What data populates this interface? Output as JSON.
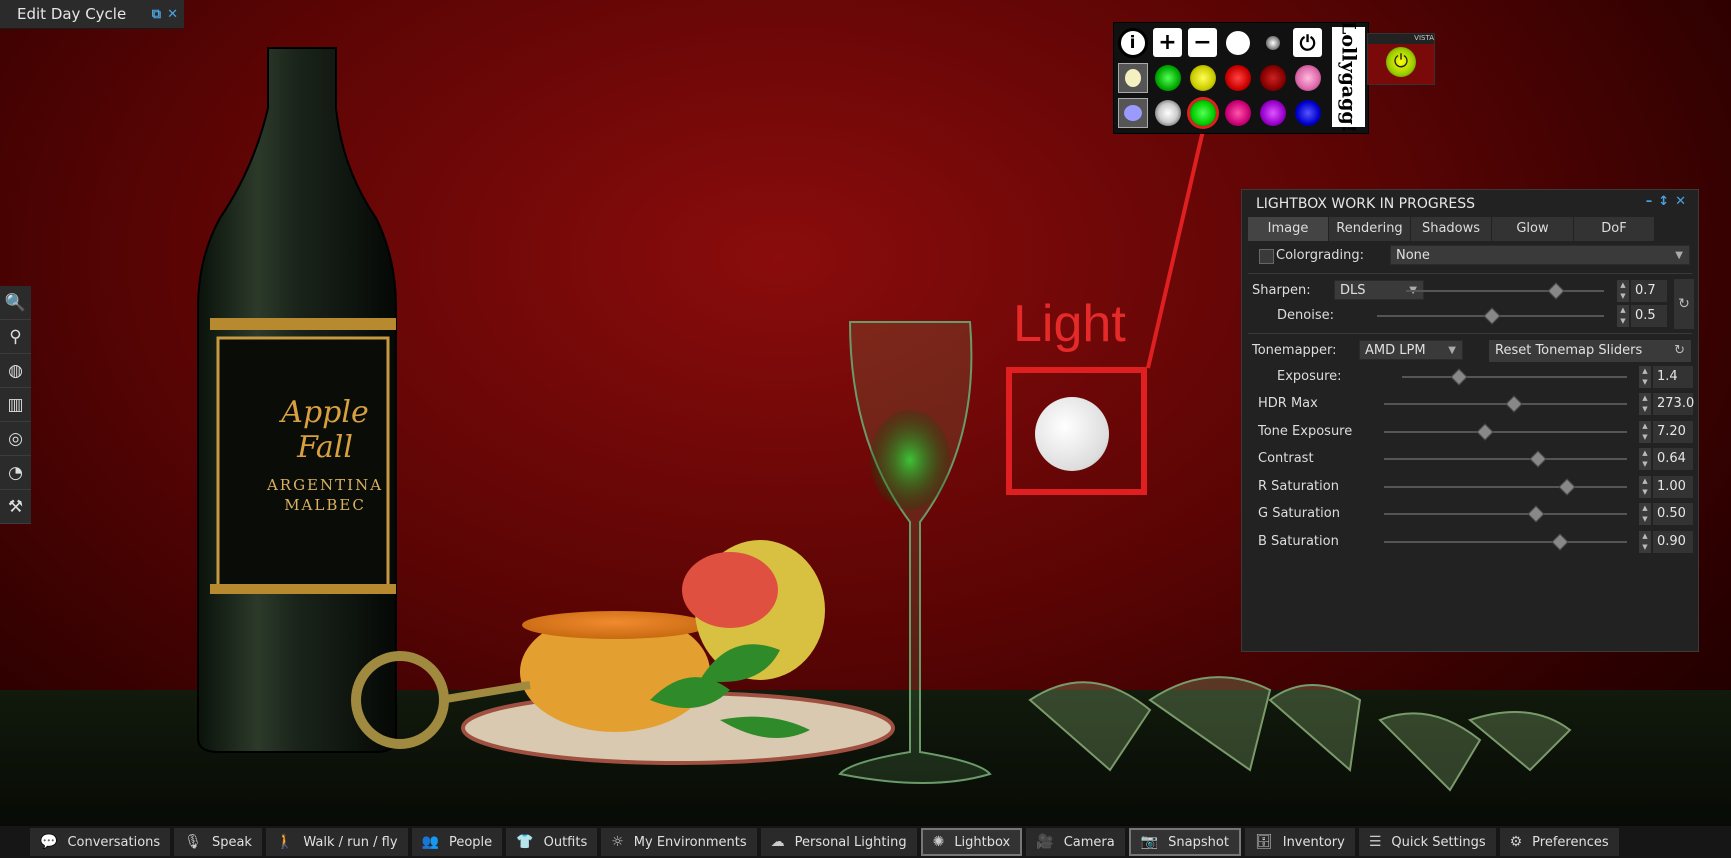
{
  "window": {
    "title": "Edit Day Cycle"
  },
  "left_toolbar": [
    {
      "icon": "search-icon",
      "glyph": "🔍"
    },
    {
      "icon": "location-pin-icon",
      "glyph": "⚲"
    },
    {
      "icon": "globe-icon",
      "glyph": "◍"
    },
    {
      "icon": "map-icon",
      "glyph": "▥"
    },
    {
      "icon": "radar-icon",
      "glyph": "◎"
    },
    {
      "icon": "speedometer-icon",
      "glyph": "◔"
    },
    {
      "icon": "build-hammer-icon",
      "glyph": "⚒"
    }
  ],
  "hud": {
    "logo_text": "Lollygagg!",
    "vista_label": "VISTA",
    "buttons": [
      "i",
      "+",
      "-"
    ]
  },
  "annotation": {
    "label": "Light"
  },
  "scene": {
    "bottle_brand": "Apple Fall",
    "bottle_type": "ARGENTINA",
    "bottle_wine": "MALBEC"
  },
  "lightbox": {
    "title": "LIGHTBOX WORK IN PROGRESS",
    "tabs": [
      "Image",
      "Rendering",
      "Shadows",
      "Glow",
      "DoF"
    ],
    "active_tab": "Image",
    "colorgrading": {
      "label": "Colorgrading:",
      "value": "None",
      "checked": false
    },
    "sharpen": {
      "label": "Sharpen:",
      "mode": "DLS",
      "value": "0.7",
      "pos": 0.75
    },
    "denoise": {
      "label": "Denoise:",
      "value": "0.5",
      "pos": 0.5
    },
    "tonemapper": {
      "label": "Tonemapper:",
      "value": "AMD LPM",
      "reset_label": "Reset Tonemap Sliders"
    },
    "sliders": [
      {
        "label": "Exposure:",
        "value": "1.4",
        "pos": 0.25
      },
      {
        "label": "HDR Max",
        "value": "273.0",
        "pos": 0.53
      },
      {
        "label": "Tone Exposure",
        "value": "7.20",
        "pos": 0.41
      },
      {
        "label": "Contrast",
        "value": "0.64",
        "pos": 0.63
      },
      {
        "label": "R Saturation",
        "value": "1.00",
        "pos": 0.75
      },
      {
        "label": "G Saturation",
        "value": "0.50",
        "pos": 0.62
      },
      {
        "label": "B Saturation",
        "value": "0.90",
        "pos": 0.72
      }
    ]
  },
  "bottom_bar": [
    {
      "label": "Conversations",
      "icon": "chat-bubble-icon",
      "glyph": "💬",
      "selected": false
    },
    {
      "label": "Speak",
      "icon": "microphone-icon",
      "glyph": "🎙",
      "selected": false
    },
    {
      "label": "Walk / run / fly",
      "icon": "walk-icon",
      "glyph": "🚶",
      "selected": false
    },
    {
      "label": "People",
      "icon": "people-icon",
      "glyph": "👥",
      "selected": false
    },
    {
      "label": "Outfits",
      "icon": "tshirt-icon",
      "glyph": "👕",
      "selected": false
    },
    {
      "label": "My Environments",
      "icon": "sun-icon",
      "glyph": "☼",
      "selected": false
    },
    {
      "label": "Personal Lighting",
      "icon": "cloud-icon",
      "glyph": "☁",
      "selected": false
    },
    {
      "label": "Lightbox",
      "icon": "lightbox-icon",
      "glyph": "✺",
      "selected": true
    },
    {
      "label": "Camera",
      "icon": "camera-icon",
      "glyph": "🎥",
      "selected": false
    },
    {
      "label": "Snapshot",
      "icon": "snapshot-icon",
      "glyph": "📷",
      "selected": true
    },
    {
      "label": "Inventory",
      "icon": "inventory-icon",
      "glyph": "🗄",
      "selected": false
    },
    {
      "label": "Quick Settings",
      "icon": "list-icon",
      "glyph": "☰",
      "selected": false
    },
    {
      "label": "Preferences",
      "icon": "gear-icon",
      "glyph": "⚙",
      "selected": false
    }
  ]
}
